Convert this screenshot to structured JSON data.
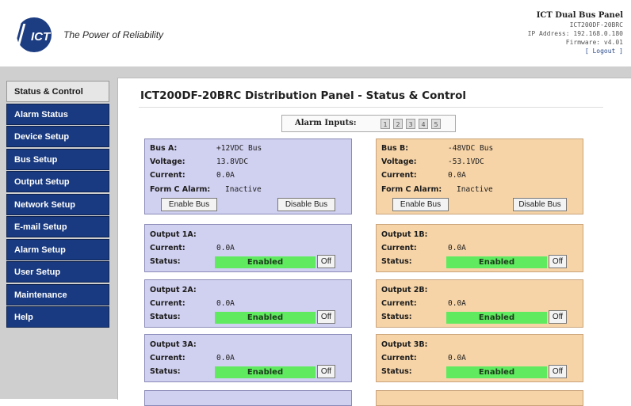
{
  "header": {
    "tagline": "The Power of Reliability",
    "logo_text": "ICT",
    "panel_title": "ICT Dual Bus Panel",
    "model": "ICT200DF-20BRC",
    "ip_line": "IP Address: 192.168.0.180",
    "firmware_line": "Firmware: v4.01",
    "logout": "[ Logout ]"
  },
  "sidebar": {
    "items": [
      {
        "label": "Status & Control",
        "active": true
      },
      {
        "label": "Alarm Status"
      },
      {
        "label": "Device Setup"
      },
      {
        "label": "Bus Setup"
      },
      {
        "label": "Output Setup"
      },
      {
        "label": "Network Setup"
      },
      {
        "label": "E-mail Setup"
      },
      {
        "label": "Alarm Setup"
      },
      {
        "label": "User Setup"
      },
      {
        "label": "Maintenance"
      },
      {
        "label": "Help"
      }
    ]
  },
  "main": {
    "title": "ICT200DF-20BRC Distribution Panel - Status & Control",
    "alarm_inputs": {
      "label": "Alarm Inputs:",
      "inputs": [
        "1",
        "2",
        "3",
        "4",
        "5"
      ]
    }
  },
  "labels": {
    "voltage": "Voltage:",
    "current": "Current:",
    "status": "Status:",
    "form_c": "Form C Alarm:",
    "enable_bus": "Enable Bus",
    "disable_bus": "Disable Bus",
    "off": "Off"
  },
  "bus_a": {
    "name": "Bus A:",
    "type": "+12VDC Bus",
    "voltage": "13.8VDC",
    "current": "0.0A",
    "form_c": "Inactive"
  },
  "bus_b": {
    "name": "Bus B:",
    "type": "-48VDC Bus",
    "voltage": "-53.1VDC",
    "current": "0.0A",
    "form_c": "Inactive"
  },
  "outputs_a": [
    {
      "name": "Output 1A:",
      "current": "0.0A",
      "status": "Enabled"
    },
    {
      "name": "Output 2A:",
      "current": "0.0A",
      "status": "Enabled"
    },
    {
      "name": "Output 3A:",
      "current": "0.0A",
      "status": "Enabled"
    }
  ],
  "outputs_b": [
    {
      "name": "Output 1B:",
      "current": "0.0A",
      "status": "Enabled"
    },
    {
      "name": "Output 2B:",
      "current": "0.0A",
      "status": "Enabled"
    },
    {
      "name": "Output 3B:",
      "current": "0.0A",
      "status": "Enabled"
    }
  ],
  "colors": {
    "nav": "#193a80",
    "bus_a_bg": "#d0d0f0",
    "bus_b_bg": "#f6d4a8",
    "enabled": "#5fea5f"
  }
}
